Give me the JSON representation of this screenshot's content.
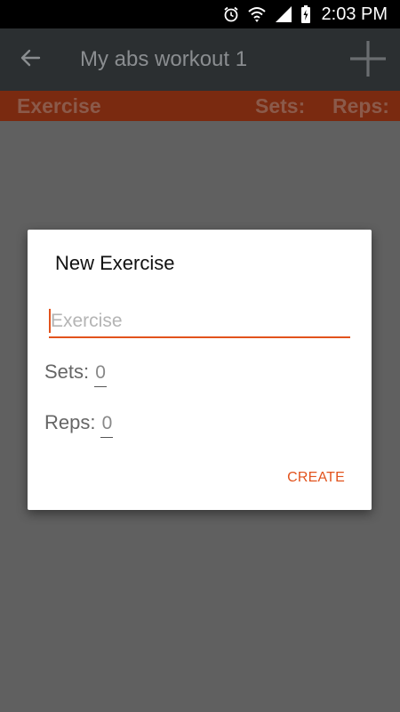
{
  "status_bar": {
    "time": "2:03 PM",
    "icons": [
      "alarm-icon",
      "wifi-icon",
      "signal-icon",
      "battery-icon"
    ]
  },
  "app_bar": {
    "title": "My abs workout 1",
    "back_icon": "back-arrow-icon",
    "add_icon": "plus-icon"
  },
  "header": {
    "exercise": "Exercise",
    "sets": "Sets:",
    "reps": "Reps:"
  },
  "dialog": {
    "title": "New Exercise",
    "exercise_placeholder": "Exercise",
    "exercise_value": "",
    "sets_label": "Sets:",
    "sets_value": "0",
    "reps_label": "Reps:",
    "reps_value": "0",
    "create_label": "CREATE"
  },
  "colors": {
    "accent": "#e2531d",
    "app_bar": "#2b2f31",
    "header": "#7a2a10",
    "scrim": "#606060"
  }
}
